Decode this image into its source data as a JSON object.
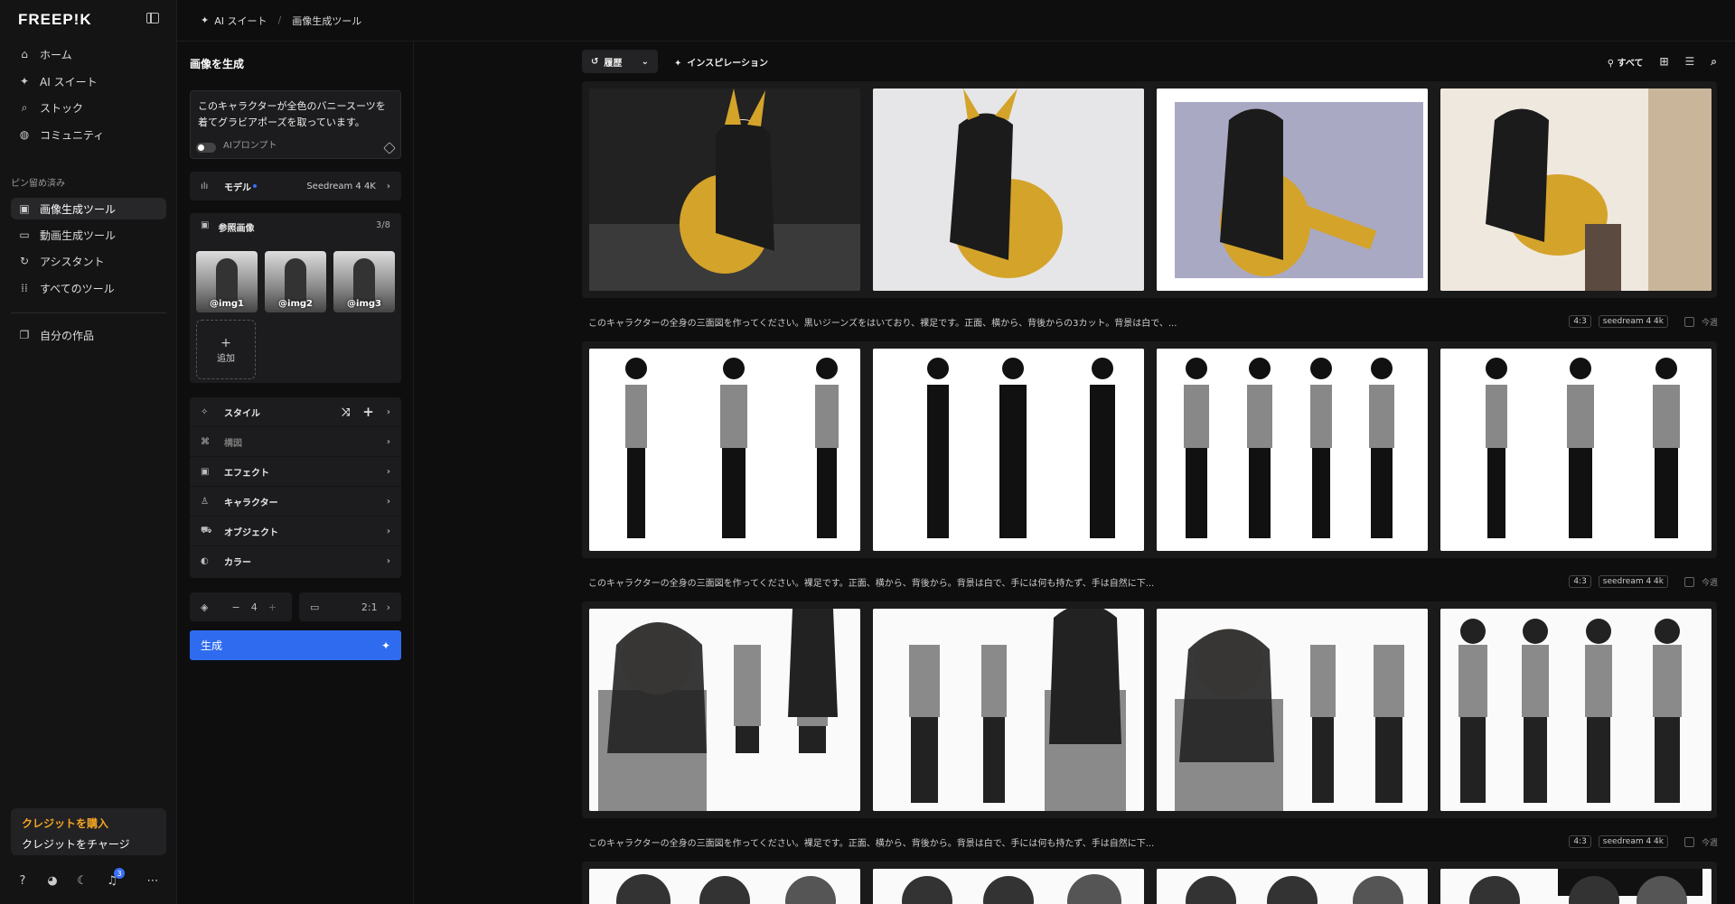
{
  "sidebar": {
    "logo": "FREEP!K",
    "nav": [
      {
        "label": "ホーム",
        "icon": "home-icon"
      },
      {
        "label": "AI スイート",
        "icon": "sparkle-icon"
      },
      {
        "label": "ストック",
        "icon": "search-icon"
      },
      {
        "label": "コミュニティ",
        "icon": "globe-icon"
      }
    ],
    "pinned_label": "ピン留め済み",
    "pinned": [
      {
        "label": "画像生成ツール",
        "icon": "image-icon",
        "active": true
      },
      {
        "label": "動画生成ツール",
        "icon": "video-icon"
      },
      {
        "label": "アシスタント",
        "icon": "chat-icon"
      },
      {
        "label": "すべてのツール",
        "icon": "grid-icon"
      }
    ],
    "my_works": "自分の作品",
    "credit": {
      "buy": "クレジットを購入",
      "charge": "クレジットをチャージ"
    },
    "notification_count": "3"
  },
  "breadcrumb": {
    "root": "AI スイート",
    "current": "画像生成ツール"
  },
  "panel": {
    "title": "画像を生成",
    "prompt": "このキャラクターが全色のバニースーツを着てグラビアポーズを取っています。",
    "ai_prompt_label": "AIプロンプト",
    "model_label": "モデル",
    "model_value": "Seedream 4 4K",
    "ref_label": "参照画像",
    "ref_count": "3/8",
    "refs": [
      "@img1",
      "@img2",
      "@img3"
    ],
    "add_label": "追加",
    "styles": [
      {
        "label": "スタイル",
        "icon": "style-icon"
      },
      {
        "label": "構図",
        "icon": "composition-icon",
        "dim": true
      },
      {
        "label": "エフェクト",
        "icon": "effect-icon"
      },
      {
        "label": "キャラクター",
        "icon": "person-icon"
      },
      {
        "label": "オブジェクト",
        "icon": "object-icon"
      },
      {
        "label": "カラー",
        "icon": "palette-icon"
      }
    ],
    "count": "4",
    "ratio": "2:1",
    "generate": "生成"
  },
  "gallery": {
    "history": "履歴",
    "inspiration": "インスピレーション",
    "filter": "すべて",
    "captions": [
      {
        "text": "このキャラクターの全身の三面図を作ってください。黒いジーンズをはいており、裸足です。正面、横から、背後からの3カット。背景は白で、...",
        "ratio": "4:3",
        "model": "seedream 4 4k",
        "date": "今週"
      },
      {
        "text": "このキャラクターの全身の三面図を作ってください。裸足です。正面、横から、背後から。背景は白で、手には何も持たず、手は自然に下...",
        "ratio": "4:3",
        "model": "seedream 4 4k",
        "date": "今週"
      },
      {
        "text": "このキャラクターの全身の三面図を作ってください。裸足です。正面、横から、背後から。背景は白で、手には何も持たず、手は自然に下...",
        "ratio": "4:3",
        "model": "seedream 4 4k",
        "date": "今週"
      }
    ]
  },
  "colors": {
    "accent": "#2f6bef",
    "credit": "#f5a623",
    "gold": "#d4a32a"
  }
}
